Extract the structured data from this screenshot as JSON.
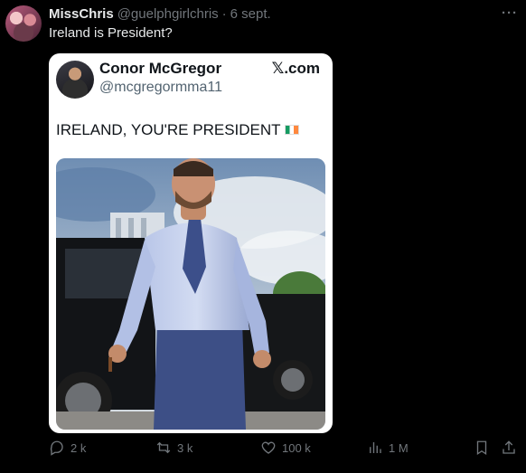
{
  "author": {
    "display_name": "MissChris",
    "handle": "@guelphgirlchris",
    "separator": "·",
    "date": "6 sept."
  },
  "tweet": {
    "text": "Ireland is President?"
  },
  "embed": {
    "name": "Conor McGregor",
    "handle": "@mcgregormma11",
    "brand": "𝕏.com",
    "text": "IRELAND, YOU'RE PRESIDENT"
  },
  "actions": {
    "replies": "2 k",
    "reposts": "3 k",
    "likes": "100 k",
    "views": "1 M"
  },
  "colors": {
    "background": "#000000",
    "text_primary": "#e7e9ea",
    "text_secondary": "#71767b",
    "card": "#ffffff"
  },
  "icons": [
    "more-icon",
    "reply-icon",
    "repost-icon",
    "like-icon",
    "views-icon",
    "bookmark-icon",
    "share-icon",
    "ireland-flag-icon"
  ]
}
